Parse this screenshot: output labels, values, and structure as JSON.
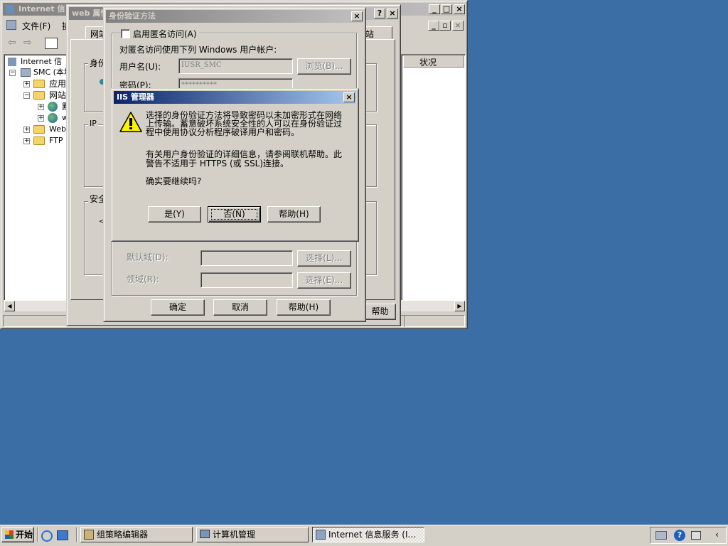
{
  "mmc": {
    "title": "Internet 信",
    "menu": {
      "file": "文件(F)",
      "more": "操"
    },
    "tree": [
      "Internet 信",
      "SMC (本地",
      "应用",
      "网站",
      "默",
      "w",
      "Web",
      "FTP"
    ],
    "list_header_status": "状况"
  },
  "props": {
    "title": "web 属性",
    "tab_site": "网站",
    "tab_right": "站",
    "group_auth": "身份",
    "group_ip": "IP",
    "group_secure": "安全",
    "help_partial": "帮助"
  },
  "auth": {
    "title": "身份验证方法",
    "anon_checkbox": "启用匿名访问(A)",
    "anon_desc": "对匿名访问使用下列 Windows 用户帐户:",
    "username_label": "用户名(U):",
    "username_value": "IUSR_SMC",
    "browse_button": "浏览(B)...",
    "password_label": "密码(P):",
    "password_value": "**********",
    "default_domain_label": "默认域(D):",
    "default_domain_button": "选择(L)...",
    "realm_label": "领域(R):",
    "realm_button": "选择(E)...",
    "ok_button": "确定",
    "cancel_button": "取消",
    "help_button": "帮助(H)"
  },
  "iis": {
    "title": "IIS 管理器",
    "message_lines": [
      "选择的身份验证方法将导致密码以未加密形式在网络",
      "上传输。蓄意破坏系统安全性的人可以在身份验证过",
      "程中使用协议分析程序破译用户和密码。"
    ],
    "info_lines": [
      "有关用户身份验证的详细信息，请参阅联机帮助。此",
      "警告不适用于 HTTPS (或 SSL)连接。"
    ],
    "question": "确实要继续吗?",
    "yes_button": "是(Y)",
    "no_button": "否(N)",
    "help_button": "帮助(H)"
  },
  "taskbar": {
    "start": "开始",
    "tasks": [
      "组策略编辑器",
      "计算机管理",
      "Internet 信息服务 (I..."
    ]
  },
  "colors": {
    "desktop": "#3a6ea5",
    "active_title": "#0a246a",
    "face": "#d4d0c8"
  }
}
